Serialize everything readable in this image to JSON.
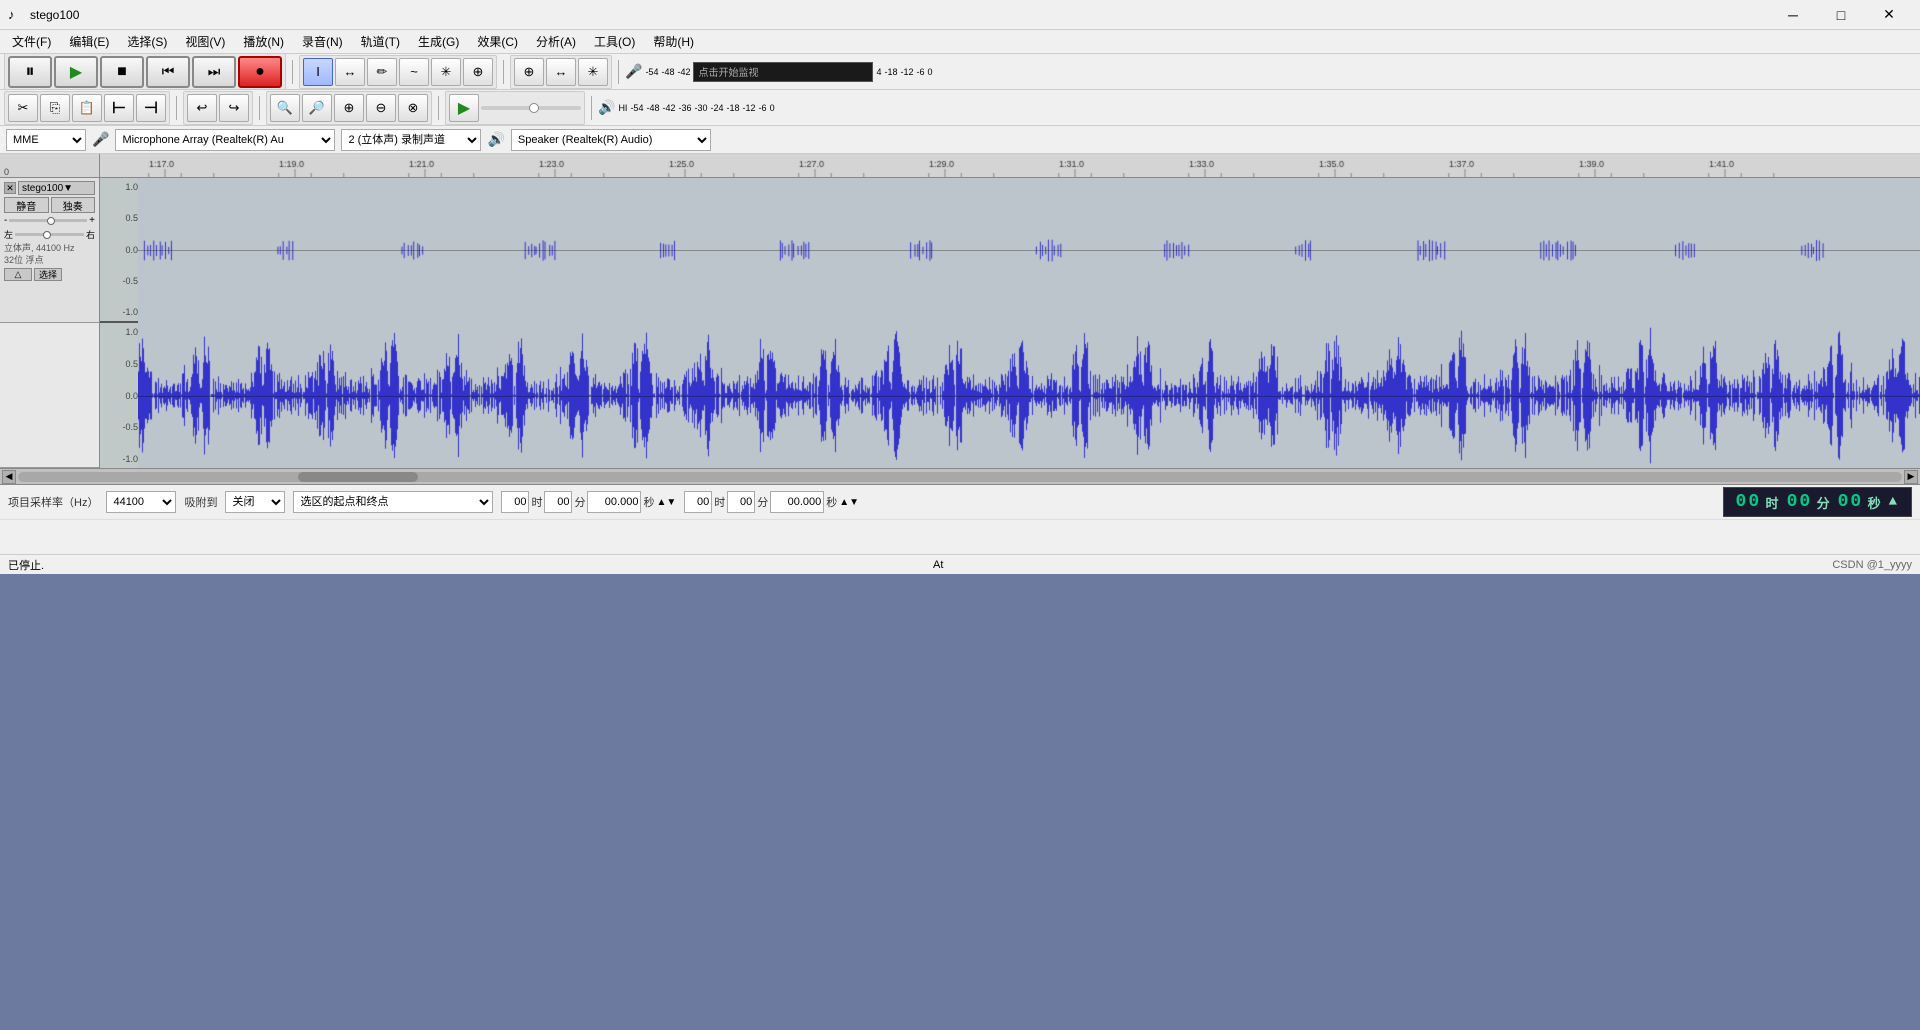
{
  "titlebar": {
    "title": "stego100",
    "app_icon": "♪",
    "min_btn": "─",
    "max_btn": "□",
    "close_btn": "✕"
  },
  "menubar": {
    "items": [
      {
        "label": "文件(F)"
      },
      {
        "label": "编辑(E)"
      },
      {
        "label": "选择(S)"
      },
      {
        "label": "视图(V)"
      },
      {
        "label": "播放(N)"
      },
      {
        "label": "录音(N)"
      },
      {
        "label": "轨道(T)"
      },
      {
        "label": "生成(G)"
      },
      {
        "label": "效果(C)"
      },
      {
        "label": "分析(A)"
      },
      {
        "label": "工具(O)"
      },
      {
        "label": "帮助(H)"
      }
    ]
  },
  "toolbar1": {
    "pause_label": "⏸",
    "play_label": "▶",
    "stop_label": "■",
    "prev_label": "⏮",
    "next_label": "⏭",
    "record_label": "●",
    "sep": "|",
    "cursor_label": "I",
    "select_label": "↔",
    "pencil_label": "✏",
    "envelope_label": "~",
    "multi_label": "#",
    "zoom_label": "⊕",
    "sep2": "|",
    "mic_label": "🎤",
    "db_label": "-54",
    "db2": "-48",
    "db3": "-42",
    "meter_label": "点击开始监视",
    "db4": "4",
    "db5": "-18",
    "db6": "-12",
    "db7": "-6",
    "db8": "0"
  },
  "toolbar2": {
    "vol_icon": "🔊",
    "hi_label": "HI",
    "db_left1": "-54",
    "db_left2": "-48",
    "db_left3": "-42",
    "db_left4": "-36",
    "db_left5": "-30",
    "db_left6": "-24",
    "db_left7": "-18",
    "db_left8": "-12",
    "db_left9": "-6",
    "db_left10": "0"
  },
  "device_bar": {
    "interface_label": "MME",
    "mic_device": "Microphone Array (Realtek(R) Au",
    "channels_label": "2 (立体声) 录制声道",
    "speaker_device": "Speaker (Realtek(R) Audio)"
  },
  "timeline_ruler": {
    "marks": [
      "1:17.0",
      "1:19.0",
      "1:21.0",
      "1:23.0",
      "1:25.0",
      "1:27.0",
      "1:29.0",
      "1:31.0",
      "1:33.0",
      "1:35.0",
      "1:37.0",
      "1:39.0",
      "1:41.0"
    ],
    "start": "0"
  },
  "track1": {
    "name": "stego100",
    "close_label": "✕",
    "dropdown_label": "▼",
    "mute_label": "静音",
    "solo_label": "独奏",
    "vol_left": "左",
    "vol_right": "右",
    "vol_minus": "-",
    "vol_plus": "+",
    "pan_left": "左",
    "pan_right": "右",
    "pan_minus": "-",
    "pan_plus": "+",
    "info": "立体声, 44100 Hz\n32位 浮点",
    "mini_btn1": "△",
    "mini_btn2": "选择"
  },
  "waveform1": {
    "y_labels": [
      "1.0",
      "0.5",
      "0.0",
      "-0.5",
      "-1.0"
    ]
  },
  "waveform2": {
    "y_labels": [
      "1.0",
      "0.5",
      "0.0",
      "-0.5",
      "-1.0"
    ]
  },
  "bottom": {
    "sample_rate_label": "项目采样率（Hz）",
    "sample_rate_value": "44100",
    "attach_label": "吸附到",
    "attach_value": "关闭",
    "selection_label": "选区的起点和终点",
    "time_start_h": "00",
    "time_start_m": "00",
    "time_start_s": "00.000",
    "time_start_h_unit": "时",
    "time_start_m_unit": "分",
    "time_start_s_unit": "秒",
    "time_end_h": "00",
    "time_end_m": "00",
    "time_end_s": "00.000",
    "time_end_h_unit": "时",
    "time_end_m_unit": "分",
    "time_end_s_unit": "秒",
    "playback_time_h": "00",
    "playback_time_h_unit": "时",
    "playback_time_m": "00",
    "playback_time_m_unit": "分",
    "playback_time_s": "00",
    "playback_time_s_unit": "秒"
  },
  "statusbar": {
    "status_text": "已停止.",
    "credit": "CSDN @1_yyyy"
  },
  "at_label": "At"
}
